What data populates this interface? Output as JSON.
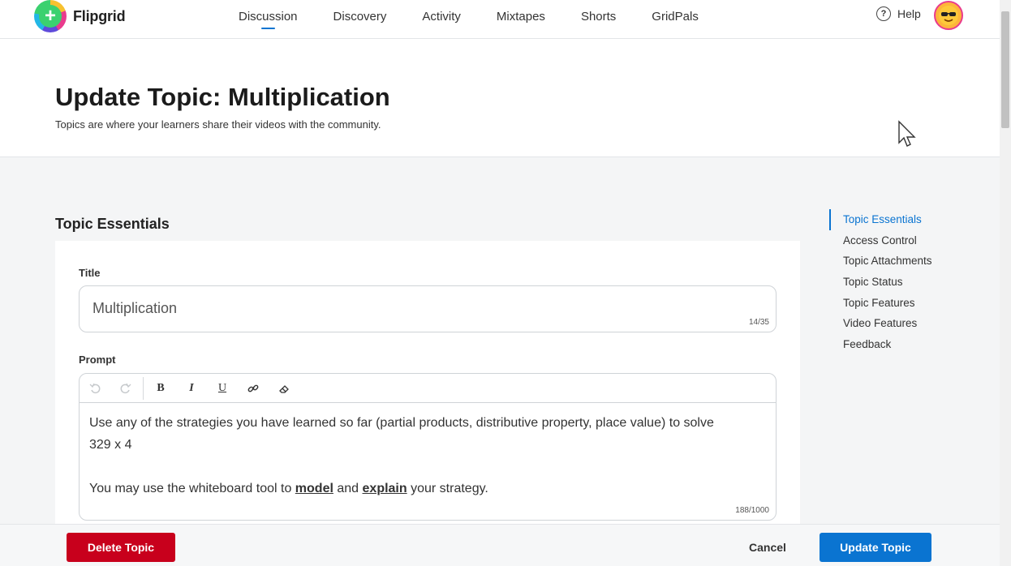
{
  "app": {
    "name": "Flipgrid"
  },
  "nav": {
    "links": [
      "Discussion",
      "Discovery",
      "Activity",
      "Mixtapes",
      "Shorts",
      "GridPals"
    ],
    "active": "Discussion",
    "help_label": "Help"
  },
  "header": {
    "title": "Update Topic: Multiplication",
    "subtitle": "Topics are where your learners share their videos with the community."
  },
  "section": {
    "title": "Topic Essentials"
  },
  "form": {
    "title_label": "Title",
    "title_value": "Multiplication",
    "title_counter": "14/35",
    "prompt_label": "Prompt",
    "prompt_line1": "Use any of the strategies you have learned so far (partial products, distributive property, place value) to solve 329 x 4",
    "prompt_line2_pre": "You may use the whiteboard tool to ",
    "prompt_line2_model": "model",
    "prompt_line2_mid": " and ",
    "prompt_line2_explain": "explain",
    "prompt_line2_post": " your strategy.",
    "prompt_counter": "188/1000",
    "toolbar": {
      "bold": "B",
      "italic": "I",
      "underline": "U"
    }
  },
  "side_nav": {
    "items": [
      "Topic Essentials",
      "Access Control",
      "Topic Attachments",
      "Topic Status",
      "Topic Features",
      "Video Features",
      "Feedback"
    ],
    "active": "Topic Essentials"
  },
  "footer": {
    "delete_label": "Delete Topic",
    "cancel_label": "Cancel",
    "update_label": "Update Topic"
  },
  "colors": {
    "accent": "#0a74d1",
    "danger": "#c8001c",
    "brand_green": "#3bd16f"
  }
}
